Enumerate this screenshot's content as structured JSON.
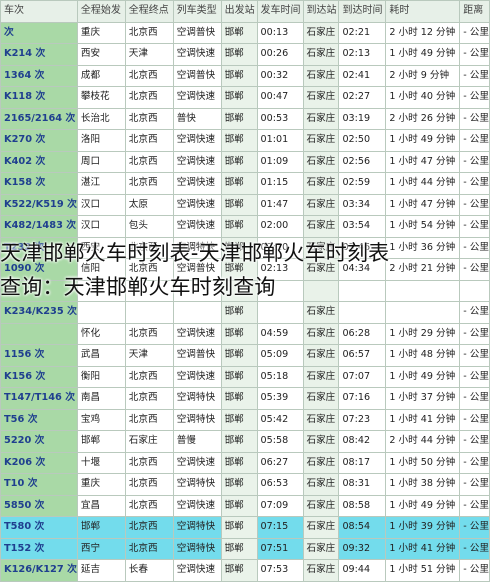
{
  "headers": [
    "车次",
    "全程始发",
    "全程终点",
    "列车类型",
    "出发站",
    "发车时间",
    "到达站",
    "到达时间",
    "耗时",
    "距离"
  ],
  "rows": [
    [
      "次",
      "重庆",
      "北京西",
      "空调普快",
      "邯郸",
      "00:13",
      "石家庄",
      "02:21",
      "2 小时 12 分钟",
      "- 公里"
    ],
    [
      "K214 次",
      "西安",
      "天津",
      "空调快速",
      "邯郸",
      "00:26",
      "石家庄",
      "02:13",
      "1 小时 49 分钟",
      "- 公里"
    ],
    [
      "1364 次",
      "成都",
      "北京西",
      "空调普快",
      "邯郸",
      "00:32",
      "石家庄",
      "02:41",
      "2 小时 9 分钟",
      "- 公里"
    ],
    [
      "K118 次",
      "攀枝花",
      "北京西",
      "空调快速",
      "邯郸",
      "00:47",
      "石家庄",
      "02:27",
      "1 小时 40 分钟",
      "- 公里"
    ],
    [
      "2165/2164 次",
      "长治北",
      "北京西",
      "普快",
      "邯郸",
      "00:53",
      "石家庄",
      "03:19",
      "2 小时 26 分钟",
      "- 公里"
    ],
    [
      "K270 次",
      "洛阳",
      "北京西",
      "空调快速",
      "邯郸",
      "01:01",
      "石家庄",
      "02:50",
      "1 小时 49 分钟",
      "- 公里"
    ],
    [
      "K402 次",
      "周口",
      "北京西",
      "空调快速",
      "邯郸",
      "01:09",
      "石家庄",
      "02:56",
      "1 小时 47 分钟",
      "- 公里"
    ],
    [
      "K158 次",
      "湛江",
      "北京西",
      "空调快速",
      "邯郸",
      "01:15",
      "石家庄",
      "02:59",
      "1 小时 44 分钟",
      "- 公里"
    ],
    [
      "K522/K519 次",
      "汉口",
      "太原",
      "空调快速",
      "邯郸",
      "01:47",
      "石家庄",
      "03:34",
      "1 小时 47 分钟",
      "- 公里"
    ],
    [
      "K482/1483 次",
      "汉口",
      "包头",
      "空调快速",
      "邯郸",
      "02:00",
      "石家庄",
      "03:54",
      "1 小时 54 分钟",
      "- 公里"
    ],
    [
      "T232 次",
      "西安",
      "北京西",
      "空调特快",
      "邯郸",
      "02:10",
      "石家庄",
      "03:46",
      "1 小时 36 分钟",
      "- 公里"
    ],
    [
      "1090 次",
      "信阳",
      "北京西",
      "空调普快",
      "邯郸",
      "02:13",
      "石家庄",
      "04:34",
      "2 小时 21 分钟",
      "- 公里"
    ],
    [
      "",
      "",
      "",
      "",
      "",
      "",
      "",
      "",
      "",
      ""
    ],
    [
      "K234/K235 次",
      "",
      "",
      "",
      "邯郸",
      "",
      "石家庄",
      "",
      "",
      "- 公里"
    ],
    [
      "",
      "怀化",
      "北京西",
      "空调快速",
      "邯郸",
      "04:59",
      "石家庄",
      "06:28",
      "1 小时 29 分钟",
      "- 公里"
    ],
    [
      "1156 次",
      "武昌",
      "天津",
      "空调普快",
      "邯郸",
      "05:09",
      "石家庄",
      "06:57",
      "1 小时 48 分钟",
      "- 公里"
    ],
    [
      "K156 次",
      "衡阳",
      "北京西",
      "空调快速",
      "邯郸",
      "05:18",
      "石家庄",
      "07:07",
      "1 小时 49 分钟",
      "- 公里"
    ],
    [
      "T147/T146 次",
      "南昌",
      "北京西",
      "空调特快",
      "邯郸",
      "05:39",
      "石家庄",
      "07:16",
      "1 小时 37 分钟",
      "- 公里"
    ],
    [
      "T56 次",
      "宝鸡",
      "北京西",
      "空调特快",
      "邯郸",
      "05:42",
      "石家庄",
      "07:23",
      "1 小时 41 分钟",
      "- 公里"
    ],
    [
      "5220 次",
      "邯郸",
      "石家庄",
      "普慢",
      "邯郸",
      "05:58",
      "石家庄",
      "08:42",
      "2 小时 44 分钟",
      "- 公里"
    ],
    [
      "K206 次",
      "十堰",
      "北京西",
      "空调快速",
      "邯郸",
      "06:27",
      "石家庄",
      "08:17",
      "1 小时 50 分钟",
      "- 公里"
    ],
    [
      "T10 次",
      "重庆",
      "北京西",
      "空调特快",
      "邯郸",
      "06:53",
      "石家庄",
      "08:31",
      "1 小时 38 分钟",
      "- 公里"
    ],
    [
      "5850 次",
      "宜昌",
      "北京西",
      "空调快速",
      "邯郸",
      "07:09",
      "石家庄",
      "08:58",
      "1 小时 49 分钟",
      "- 公里"
    ],
    [
      "T580 次",
      "邯郸",
      "北京西",
      "空调特快",
      "邯郸",
      "07:15",
      "石家庄",
      "08:54",
      "1 小时 39 分钟",
      "- 公里"
    ],
    [
      "T152 次",
      "西宁",
      "北京西",
      "空调特快",
      "邯郸",
      "07:51",
      "石家庄",
      "09:32",
      "1 小时 41 分钟",
      "- 公里"
    ],
    [
      "K126/K127 次",
      "延吉",
      "长春",
      "空调快速",
      "邯郸",
      "07:53",
      "石家庄",
      "09:44",
      "1 小时 51 分钟",
      "- 公里"
    ]
  ],
  "highlighted_rows": [
    23,
    24
  ],
  "overlay": {
    "line1": "天津邯郸火车时刻表-天津邯郸火车时刻表",
    "line2": "查询：天津邯郸火车时刻查询"
  }
}
